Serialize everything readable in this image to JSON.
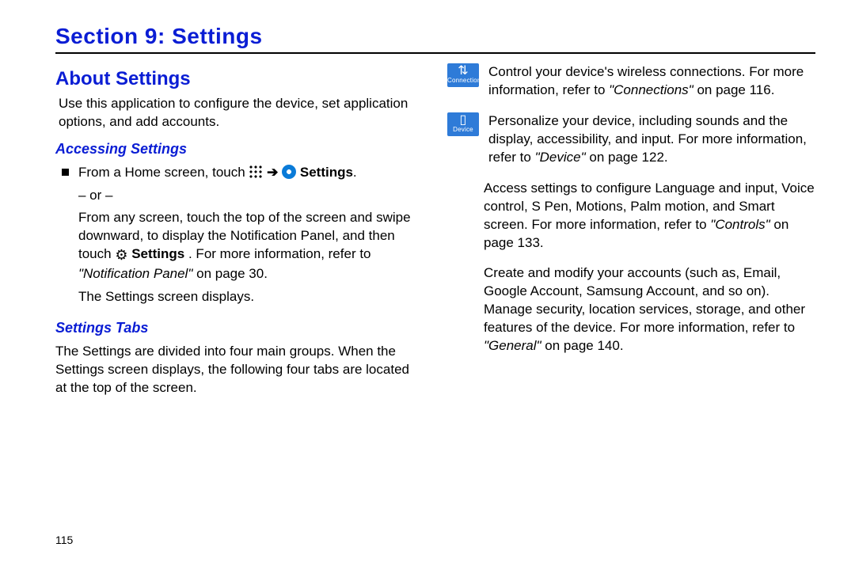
{
  "section_title": "Section 9: Settings",
  "page_number": "115",
  "left": {
    "h2": "About Settings",
    "intro": "Use this application to configure the device, set application options, and add accounts.",
    "h3a": "Accessing Settings",
    "step1_pre": "From a Home screen, touch ",
    "step1_settings": "Settings",
    "step1_period": ".",
    "or": "– or –",
    "step2a": "From any screen, touch the top of the screen and swipe downward, to display the Notification Panel, and then touch ",
    "step2_settings": "Settings",
    "step2b": ". For more information, refer to ",
    "step2_ref": "\"Notification Panel\"",
    "step2c": " on page 30.",
    "step3": "The Settings screen displays.",
    "h3b": "Settings Tabs",
    "tabs_intro": "The Settings are divided into four main groups. When the Settings screen displays, the following four tabs are located at the top of the screen."
  },
  "right": {
    "tab1_label": "Connections",
    "tab1a": "Control your device's wireless connections. For more information, refer to ",
    "tab1_ref": "\"Connections\"",
    "tab1b": " on page 116.",
    "tab2_label": "Device",
    "tab2a": "Personalize your device, including sounds and the display, accessibility, and input. For more information, refer to ",
    "tab2_ref": "\"Device\"",
    "tab2b": " on page 122.",
    "tab3a": "Access settings to configure Language and input, Voice control, S Pen, Motions, Palm motion, and Smart screen. For more information, refer to ",
    "tab3_ref": "\"Controls\"",
    "tab3b": " on page 133.",
    "tab4a": "Create and modify your accounts (such as, Email, Google Account, Samsung Account, and so on). Manage security, location services, storage, and other features of the device. For more information, refer to ",
    "tab4_ref": "\"General\"",
    "tab4b": " on page 140."
  }
}
